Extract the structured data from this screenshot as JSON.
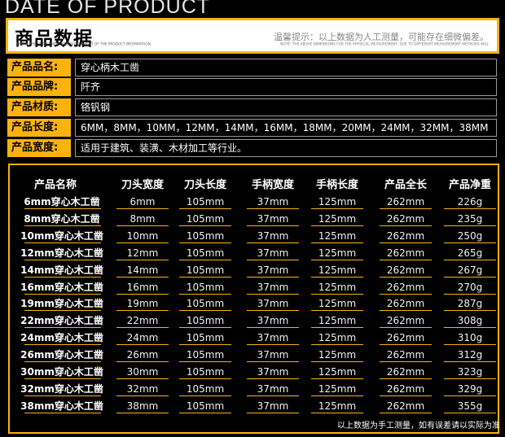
{
  "top_title": "DATE OF PRODUCT",
  "banner": {
    "title": "商品数据",
    "subtitle": "THIS IS THE SUPPLEMENT AND SUPPLEMENT OF THE PRODUCT INFORMATION.",
    "notice": "温馨提示：以上数据为人工测量，可能存在细微偏差。",
    "notice_sub": "NOTE: THE ABOVE DIMENSIONS FOR THE PHYSICAL MEASUREMENT, DUE TO DIFFERENT MEASUREMENT METHODS WILL"
  },
  "specs": [
    {
      "label": "产品品名:",
      "value": "穿心柄木工凿"
    },
    {
      "label": "产品品牌:",
      "value": "阡齐"
    },
    {
      "label": "产品材质:",
      "value": "铬钒钢"
    },
    {
      "label": "产品长度:",
      "value": "6MM，8MM，10MM，12MM，14MM，16MM，18MM，20MM，24MM，32MM，38MM"
    },
    {
      "label": "产品宽度:",
      "value": "适用于建筑、装潢、木材加工等行业。"
    }
  ],
  "table": {
    "headers": [
      "产品名称",
      "刀头宽度",
      "刀头长度",
      "手柄宽度",
      "手柄长度",
      "产品全长",
      "产品净重"
    ],
    "rows": [
      [
        "6mm穿心木工凿",
        "6mm",
        "105mm",
        "37mm",
        "125mm",
        "262mm",
        "226g"
      ],
      [
        "8mm穿心木工凿",
        "8mm",
        "105mm",
        "37mm",
        "125mm",
        "262mm",
        "235g"
      ],
      [
        "10mm穿心木工凿",
        "10mm",
        "105mm",
        "37mm",
        "125mm",
        "262mm",
        "250g"
      ],
      [
        "12mm穿心木工凿",
        "12mm",
        "105mm",
        "37mm",
        "125mm",
        "262mm",
        "265g"
      ],
      [
        "14mm穿心木工凿",
        "14mm",
        "105mm",
        "37mm",
        "125mm",
        "262mm",
        "267g"
      ],
      [
        "16mm穿心木工凿",
        "16mm",
        "105mm",
        "37mm",
        "125mm",
        "262mm",
        "270g"
      ],
      [
        "19mm穿心木工凿",
        "19mm",
        "105mm",
        "37mm",
        "125mm",
        "262mm",
        "287g"
      ],
      [
        "22mm穿心木工凿",
        "22mm",
        "105mm",
        "37mm",
        "125mm",
        "262mm",
        "308g"
      ],
      [
        "24mm穿心木工凿",
        "24mm",
        "105mm",
        "37mm",
        "125mm",
        "262mm",
        "310g"
      ],
      [
        "26mm穿心木工凿",
        "26mm",
        "105mm",
        "37mm",
        "125mm",
        "262mm",
        "312g"
      ],
      [
        "30mm穿心木工凿",
        "30mm",
        "105mm",
        "37mm",
        "125mm",
        "262mm",
        "323g"
      ],
      [
        "32mm穿心木工凿",
        "32mm",
        "105mm",
        "37mm",
        "125mm",
        "262mm",
        "329g"
      ],
      [
        "38mm穿心木工凿",
        "38mm",
        "105mm",
        "37mm",
        "125mm",
        "262mm",
        "355g"
      ]
    ],
    "footnote": "以上数据为手工测量，如有误差请以实际为准"
  },
  "colors": {
    "accent": "#f9b30a",
    "background": "#000000"
  }
}
